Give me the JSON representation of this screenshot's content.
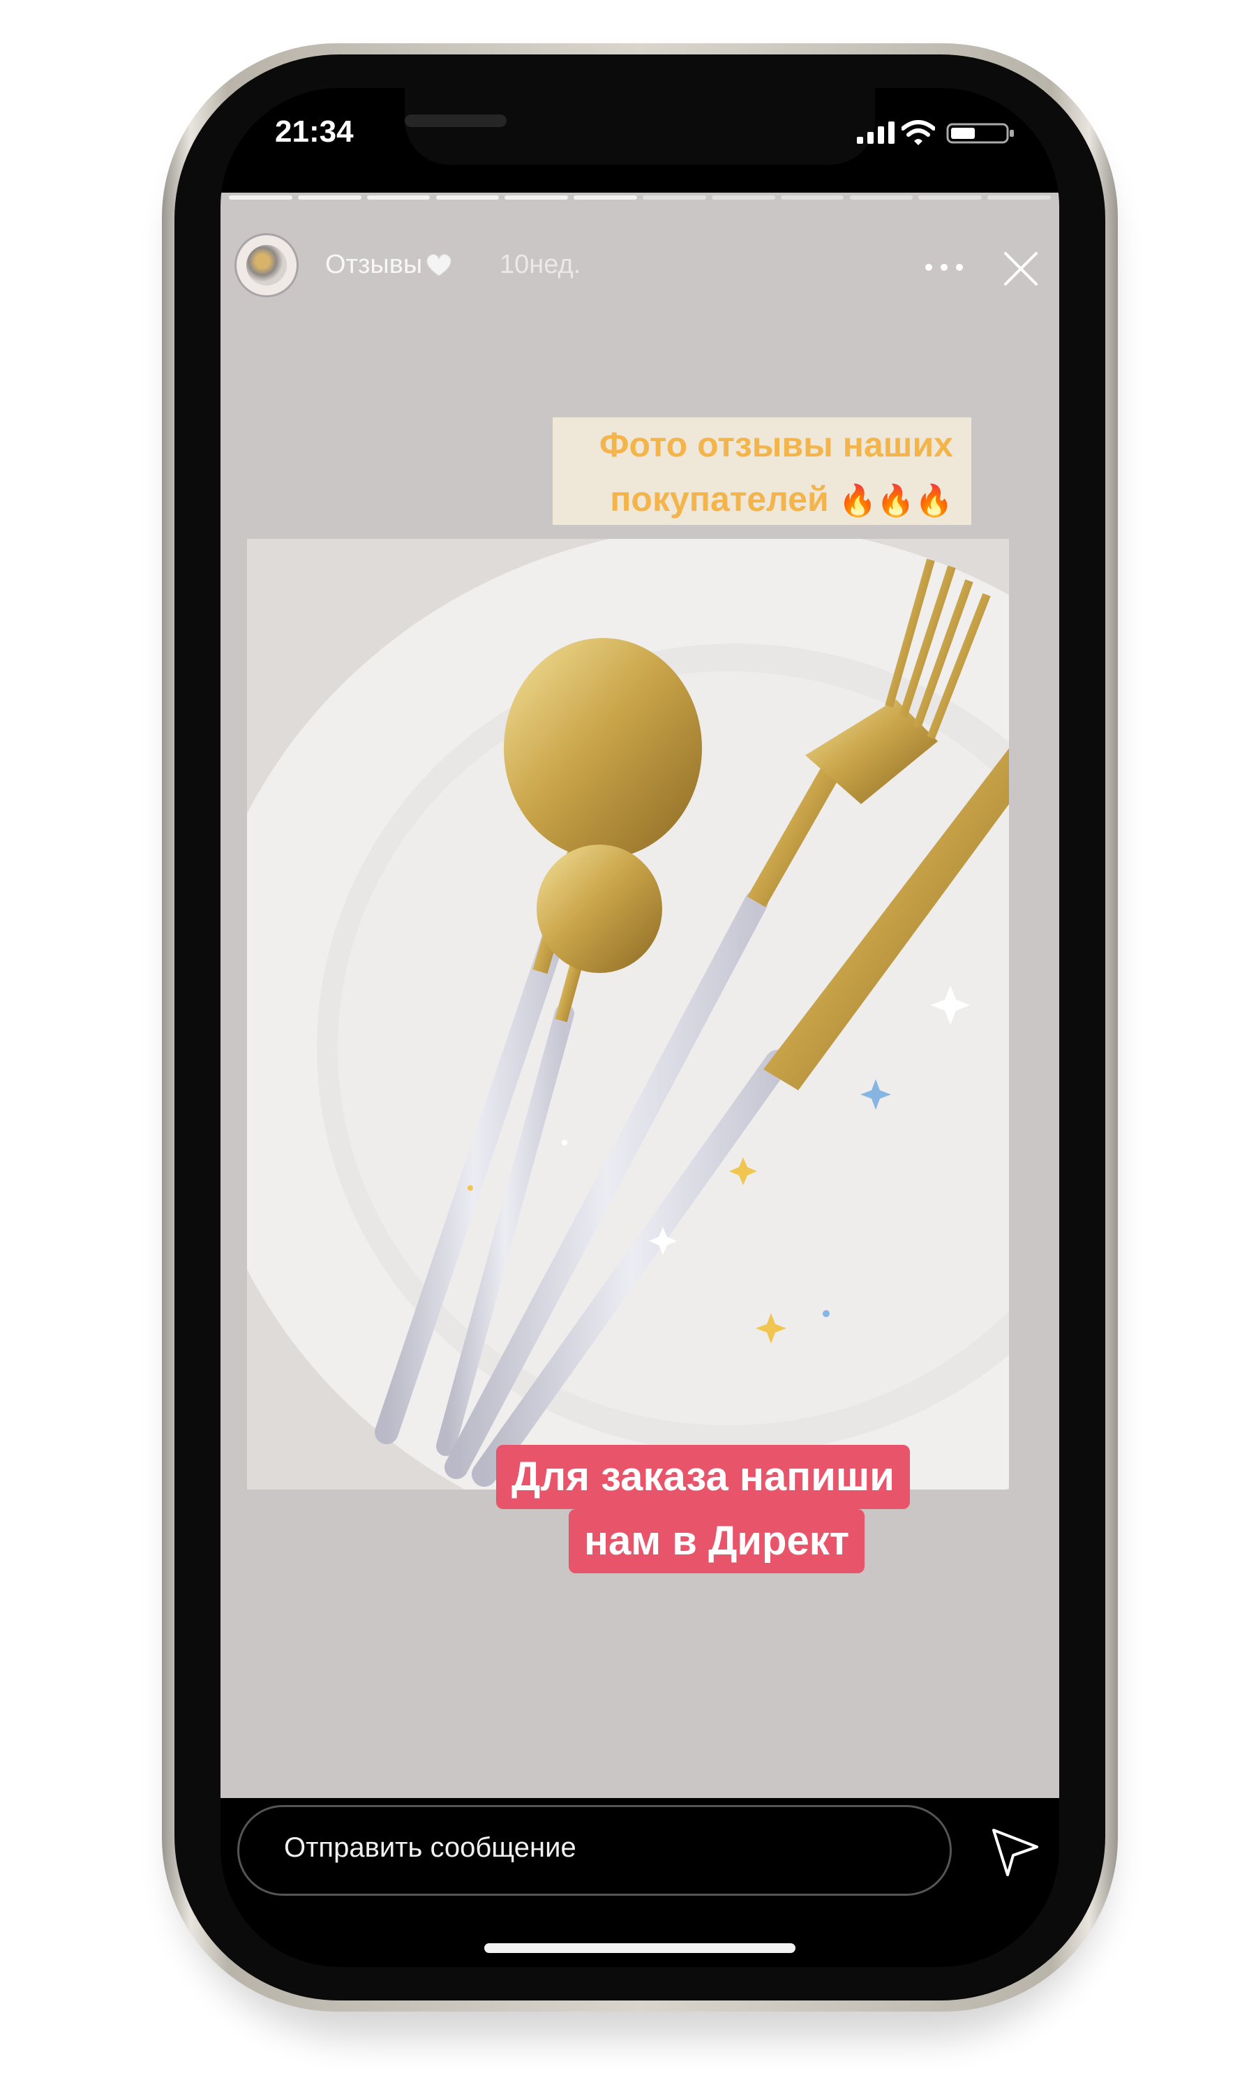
{
  "status_bar": {
    "time": "21:34",
    "icons": [
      "signal-icon",
      "wifi-icon",
      "battery-icon"
    ]
  },
  "story": {
    "progress_segments": 12,
    "completed_segments": 6,
    "title": "Отзывы",
    "time": "10нед.",
    "caption_top": {
      "line1": "Фото отзывы наших",
      "line2": "покупателей",
      "emoji": "🔥🔥🔥"
    },
    "caption_bottom": {
      "line1": "Для заказа напиши",
      "line2": "нам в Директ"
    }
  },
  "message": {
    "placeholder": "Отправить сообщение"
  },
  "colors": {
    "caption_top_bg": "#efe8d8",
    "caption_top_text": "#f3b54b",
    "caption_bottom_bg": "#e8546a",
    "story_bg": "#c9c6c5"
  },
  "icons": [
    "heart-icon",
    "more-icon",
    "close-icon",
    "send-icon",
    "avatar"
  ]
}
